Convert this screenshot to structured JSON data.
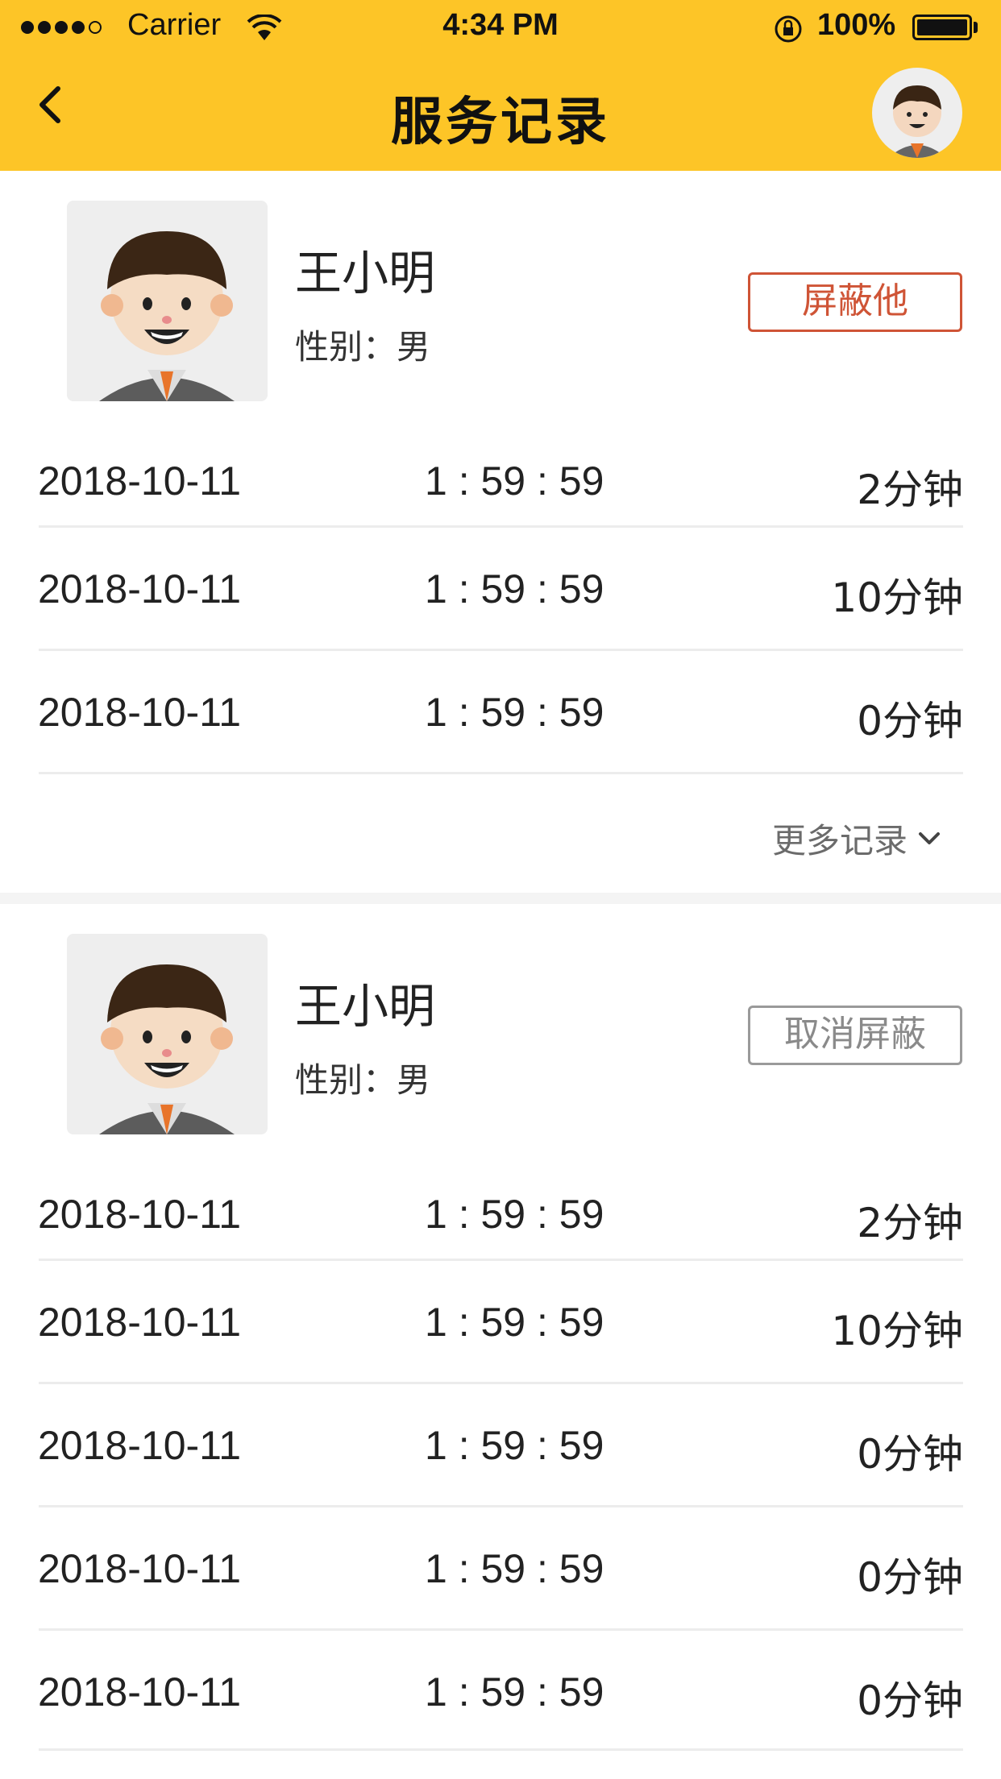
{
  "status": {
    "carrier": "Carrier",
    "time": "4:34 PM",
    "battery": "100%"
  },
  "nav": {
    "title": "服务记录"
  },
  "cards": [
    {
      "name": "王小明",
      "gender_label": "性别：男",
      "action_label": "屏蔽他",
      "records": [
        {
          "date": "2018-10-11",
          "time": "1 : 59 : 59",
          "duration": "2分钟"
        },
        {
          "date": "2018-10-11",
          "time": "1 : 59 : 59",
          "duration": "10分钟"
        },
        {
          "date": "2018-10-11",
          "time": "1 : 59 : 59",
          "duration": "0分钟"
        }
      ],
      "more_label": "更多记录"
    },
    {
      "name": "王小明",
      "gender_label": "性别：男",
      "action_label": "取消屏蔽",
      "records": [
        {
          "date": "2018-10-11",
          "time": "1 : 59 : 59",
          "duration": "2分钟"
        },
        {
          "date": "2018-10-11",
          "time": "1 : 59 : 59",
          "duration": "10分钟"
        },
        {
          "date": "2018-10-11",
          "time": "1 : 59 : 59",
          "duration": "0分钟"
        },
        {
          "date": "2018-10-11",
          "time": "1 : 59 : 59",
          "duration": "0分钟"
        },
        {
          "date": "2018-10-11",
          "time": "1 : 59 : 59",
          "duration": "0分钟"
        }
      ]
    }
  ],
  "colors": {
    "header": "#fdc527",
    "block_button": "#cf5436",
    "unblock_button": "#9a9a9a"
  }
}
